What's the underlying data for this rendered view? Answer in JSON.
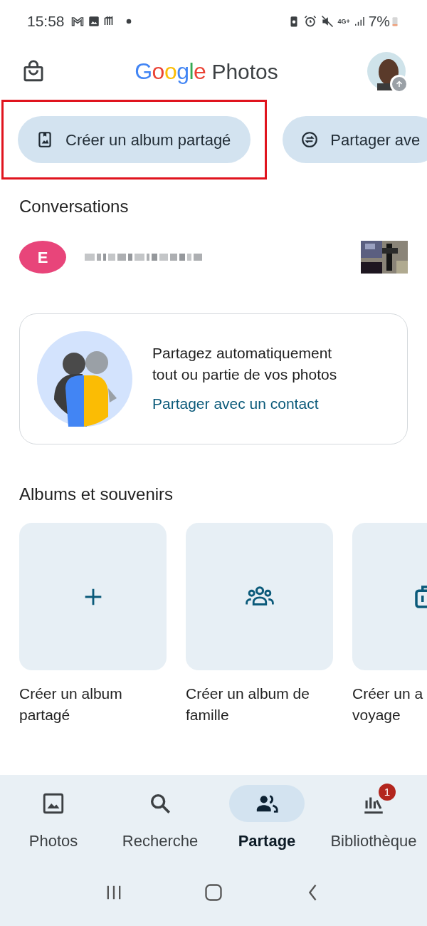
{
  "status_bar": {
    "time": "15:58",
    "battery": "7%",
    "network": "4G+"
  },
  "header": {
    "logo_brand": "Google",
    "logo_product": "Photos"
  },
  "chips": [
    {
      "label": "Créer un album partagé",
      "highlighted": true
    },
    {
      "label": "Partager ave",
      "highlighted": false
    }
  ],
  "conversations": {
    "title": "Conversations",
    "items": [
      {
        "avatar_letter": "E",
        "color": "#e8457a"
      }
    ]
  },
  "promo_card": {
    "text": "Partagez automatiquement tout ou partie de vos photos",
    "link": "Partager avec un contact"
  },
  "albums": {
    "title": "Albums et souvenirs",
    "tiles": [
      {
        "label_lines": [
          "Créer un album",
          "partagé"
        ]
      },
      {
        "label_lines": [
          "Créer un album de",
          "famille"
        ]
      },
      {
        "label_lines": [
          "Créer un a",
          "voyage"
        ]
      }
    ]
  },
  "bottom_nav": [
    {
      "label": "Photos",
      "selected": false
    },
    {
      "label": "Recherche",
      "selected": false
    },
    {
      "label": "Partage",
      "selected": true
    },
    {
      "label": "Bibliothèque",
      "selected": false,
      "badge": "1"
    }
  ]
}
